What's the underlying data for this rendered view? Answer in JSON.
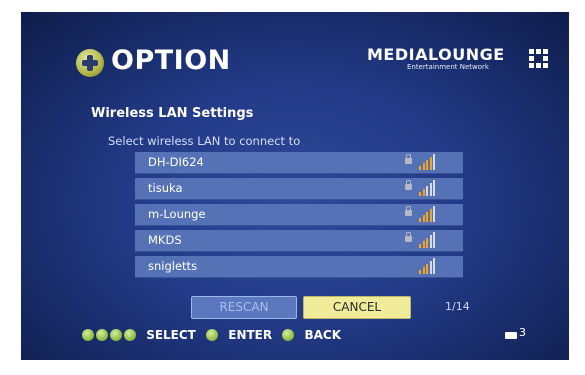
{
  "header": {
    "title": "OPTION",
    "brand_name": "MEDIALOUNGE",
    "brand_tagline": "Entertainment Network"
  },
  "section_title": "Wireless LAN Settings",
  "subtitle": "Select wireless LAN to connect to",
  "networks": [
    {
      "name": "DH-DI624",
      "locked": true,
      "signal": "strong"
    },
    {
      "name": "tisuka",
      "locked": true,
      "signal": "weak"
    },
    {
      "name": "m-Lounge",
      "locked": true,
      "signal": "strong"
    },
    {
      "name": "MKDS",
      "locked": true,
      "signal": "medium"
    },
    {
      "name": "snigletts",
      "locked": false,
      "signal": "medium"
    }
  ],
  "buttons": {
    "rescan": "RESCAN",
    "cancel": "CANCEL"
  },
  "pager": "1/14",
  "footer": {
    "select": "SELECT",
    "enter": "ENTER",
    "back": "BACK",
    "keyboard_count": "3"
  },
  "colors": {
    "background": "#223a86",
    "row": "#5672b7",
    "cancel_highlight": "#f0ec9a",
    "signal_active": "#f4a51c"
  }
}
